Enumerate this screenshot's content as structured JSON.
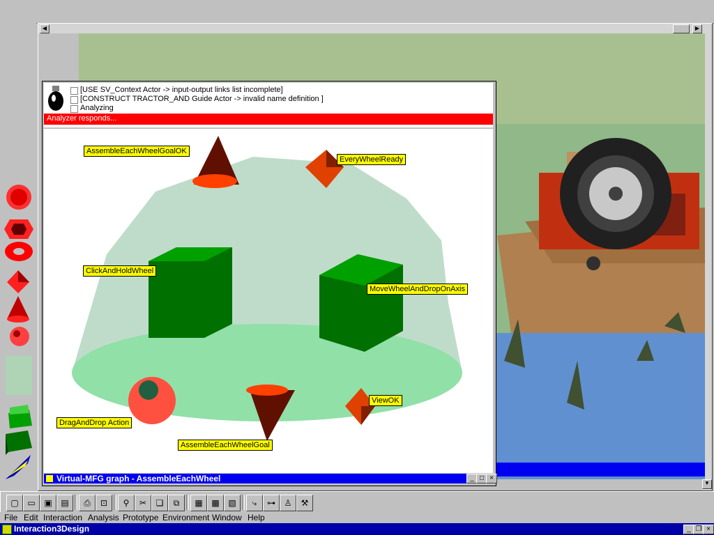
{
  "app": {
    "title": "Interaction3Design"
  },
  "menu": [
    "File",
    "Edit",
    "Interaction",
    "Analysis",
    "Prototype",
    "Environment",
    "Window",
    "Help"
  ],
  "toolbar": {
    "icons": [
      "new-icon",
      "open-icon",
      "save-icon",
      "save-all-icon",
      "print-icon",
      "print-preview-icon",
      "wand-icon",
      "cut-icon",
      "copy-icon",
      "paste-icon",
      "layout-icon",
      "image-icon",
      "scene-icon",
      "hook-icon",
      "connect-icon",
      "person-icon",
      "tool-icon"
    ]
  },
  "graph_window": {
    "title": "Virtual-MFG graph - AssembleEachWheel",
    "analyzer": {
      "status": "Analyzer responds...",
      "items": [
        {
          "checked": false,
          "text": "Analyzing"
        },
        {
          "checked": false,
          "text": "[CONSTRUCT TRACTOR_AND Guide Actor -> invalid name definition ]"
        },
        {
          "checked": false,
          "text": "[USE SV_Context Actor -> input-output links list incomplete]"
        }
      ]
    },
    "nodes": {
      "goal_ok": "AssembleEachWheelGoalOK",
      "every_ready": "EveryWheelReady",
      "click_hold": "ClickAndHoldWheel",
      "move_drop": "MoveWheelAndDropOnAxis",
      "view_ok": "ViewOK",
      "drag_drop": "DragAndDrop Action",
      "goal": "AssembleEachWheelGoal"
    }
  },
  "colors": {
    "titlebar": "#0000a8",
    "analyzer_bar": "#ff0000",
    "label_bg": "#ffff00"
  }
}
